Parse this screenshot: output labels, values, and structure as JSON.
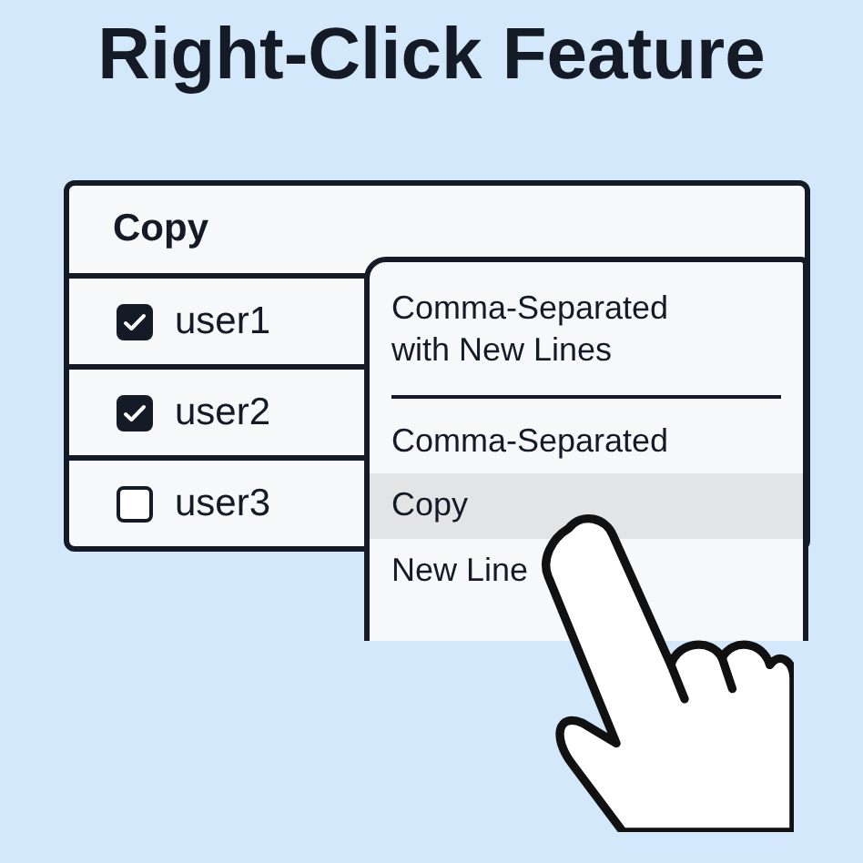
{
  "title": "Right-Click Feature",
  "table": {
    "header": "Copy",
    "rows": [
      {
        "label": "user1",
        "checked": true
      },
      {
        "label": "user2",
        "checked": true
      },
      {
        "label": "user3",
        "checked": false
      }
    ]
  },
  "context_menu": {
    "items": [
      {
        "kind": "item",
        "label": "Comma-Separated with New Lines",
        "selected": false
      },
      {
        "kind": "divider"
      },
      {
        "kind": "item",
        "label": "Comma-Separated",
        "selected": false
      },
      {
        "kind": "item",
        "label": "Copy",
        "selected": true
      },
      {
        "kind": "item",
        "label": "New Line",
        "selected": false
      }
    ]
  }
}
